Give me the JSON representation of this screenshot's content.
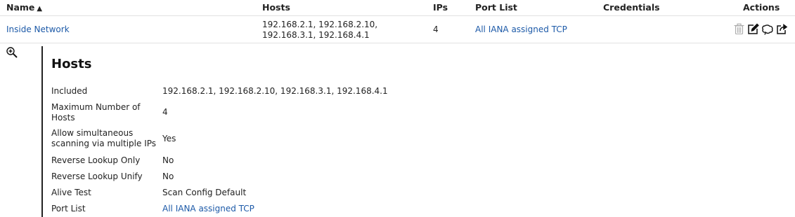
{
  "table": {
    "columns": {
      "name": "Name",
      "sort_indicator": "▲",
      "hosts": "Hosts",
      "ips": "IPs",
      "port_list": "Port List",
      "credentials": "Credentials",
      "actions": "Actions"
    },
    "row": {
      "name": "Inside Network",
      "hosts_line1": "192.168.2.1, 192.168.2.10,",
      "hosts_line2": "192.168.3.1, 192.168.4.1",
      "ips": "4",
      "port_list": "All IANA assigned TCP",
      "credentials": "",
      "actions": [
        "trash-icon",
        "edit-icon",
        "clone-icon",
        "export-icon"
      ]
    }
  },
  "details": {
    "title": "Hosts",
    "rows": [
      {
        "label": "Included",
        "value": "192.168.2.1, 192.168.2.10, 192.168.3.1, 192.168.4.1"
      },
      {
        "label": "Maximum Number of Hosts",
        "value": "4"
      },
      {
        "label": "Allow simultaneous scanning via multiple IPs",
        "value": "Yes"
      },
      {
        "label": "Reverse Lookup Only",
        "value": "No"
      },
      {
        "label": "Reverse Lookup Unify",
        "value": "No"
      },
      {
        "label": "Alive Test",
        "value": "Scan Config Default"
      },
      {
        "label": "Port List",
        "value": "All IANA assigned TCP"
      }
    ]
  },
  "colors": {
    "link": "#1d5aa8",
    "text": "#222222",
    "divider": "#e2e2e2"
  }
}
